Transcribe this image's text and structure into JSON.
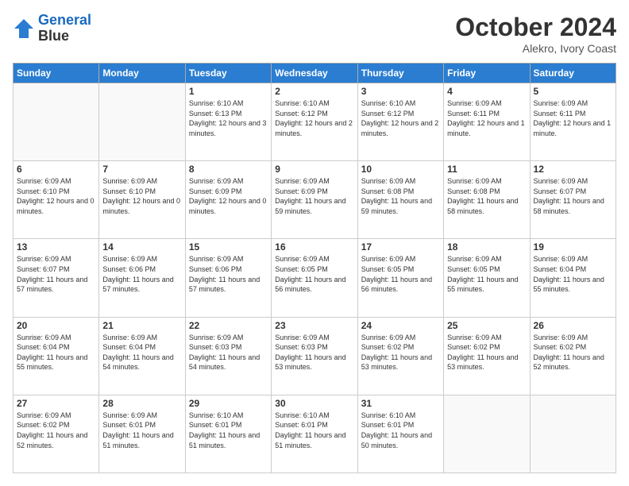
{
  "header": {
    "logo_line1": "General",
    "logo_line2": "Blue",
    "month": "October 2024",
    "location": "Alekro, Ivory Coast"
  },
  "weekdays": [
    "Sunday",
    "Monday",
    "Tuesday",
    "Wednesday",
    "Thursday",
    "Friday",
    "Saturday"
  ],
  "weeks": [
    [
      {
        "day": "",
        "info": ""
      },
      {
        "day": "",
        "info": ""
      },
      {
        "day": "1",
        "info": "Sunrise: 6:10 AM\nSunset: 6:13 PM\nDaylight: 12 hours and 3 minutes."
      },
      {
        "day": "2",
        "info": "Sunrise: 6:10 AM\nSunset: 6:12 PM\nDaylight: 12 hours and 2 minutes."
      },
      {
        "day": "3",
        "info": "Sunrise: 6:10 AM\nSunset: 6:12 PM\nDaylight: 12 hours and 2 minutes."
      },
      {
        "day": "4",
        "info": "Sunrise: 6:09 AM\nSunset: 6:11 PM\nDaylight: 12 hours and 1 minute."
      },
      {
        "day": "5",
        "info": "Sunrise: 6:09 AM\nSunset: 6:11 PM\nDaylight: 12 hours and 1 minute."
      }
    ],
    [
      {
        "day": "6",
        "info": "Sunrise: 6:09 AM\nSunset: 6:10 PM\nDaylight: 12 hours and 0 minutes."
      },
      {
        "day": "7",
        "info": "Sunrise: 6:09 AM\nSunset: 6:10 PM\nDaylight: 12 hours and 0 minutes."
      },
      {
        "day": "8",
        "info": "Sunrise: 6:09 AM\nSunset: 6:09 PM\nDaylight: 12 hours and 0 minutes."
      },
      {
        "day": "9",
        "info": "Sunrise: 6:09 AM\nSunset: 6:09 PM\nDaylight: 11 hours and 59 minutes."
      },
      {
        "day": "10",
        "info": "Sunrise: 6:09 AM\nSunset: 6:08 PM\nDaylight: 11 hours and 59 minutes."
      },
      {
        "day": "11",
        "info": "Sunrise: 6:09 AM\nSunset: 6:08 PM\nDaylight: 11 hours and 58 minutes."
      },
      {
        "day": "12",
        "info": "Sunrise: 6:09 AM\nSunset: 6:07 PM\nDaylight: 11 hours and 58 minutes."
      }
    ],
    [
      {
        "day": "13",
        "info": "Sunrise: 6:09 AM\nSunset: 6:07 PM\nDaylight: 11 hours and 57 minutes."
      },
      {
        "day": "14",
        "info": "Sunrise: 6:09 AM\nSunset: 6:06 PM\nDaylight: 11 hours and 57 minutes."
      },
      {
        "day": "15",
        "info": "Sunrise: 6:09 AM\nSunset: 6:06 PM\nDaylight: 11 hours and 57 minutes."
      },
      {
        "day": "16",
        "info": "Sunrise: 6:09 AM\nSunset: 6:05 PM\nDaylight: 11 hours and 56 minutes."
      },
      {
        "day": "17",
        "info": "Sunrise: 6:09 AM\nSunset: 6:05 PM\nDaylight: 11 hours and 56 minutes."
      },
      {
        "day": "18",
        "info": "Sunrise: 6:09 AM\nSunset: 6:05 PM\nDaylight: 11 hours and 55 minutes."
      },
      {
        "day": "19",
        "info": "Sunrise: 6:09 AM\nSunset: 6:04 PM\nDaylight: 11 hours and 55 minutes."
      }
    ],
    [
      {
        "day": "20",
        "info": "Sunrise: 6:09 AM\nSunset: 6:04 PM\nDaylight: 11 hours and 55 minutes."
      },
      {
        "day": "21",
        "info": "Sunrise: 6:09 AM\nSunset: 6:04 PM\nDaylight: 11 hours and 54 minutes."
      },
      {
        "day": "22",
        "info": "Sunrise: 6:09 AM\nSunset: 6:03 PM\nDaylight: 11 hours and 54 minutes."
      },
      {
        "day": "23",
        "info": "Sunrise: 6:09 AM\nSunset: 6:03 PM\nDaylight: 11 hours and 53 minutes."
      },
      {
        "day": "24",
        "info": "Sunrise: 6:09 AM\nSunset: 6:02 PM\nDaylight: 11 hours and 53 minutes."
      },
      {
        "day": "25",
        "info": "Sunrise: 6:09 AM\nSunset: 6:02 PM\nDaylight: 11 hours and 53 minutes."
      },
      {
        "day": "26",
        "info": "Sunrise: 6:09 AM\nSunset: 6:02 PM\nDaylight: 11 hours and 52 minutes."
      }
    ],
    [
      {
        "day": "27",
        "info": "Sunrise: 6:09 AM\nSunset: 6:02 PM\nDaylight: 11 hours and 52 minutes."
      },
      {
        "day": "28",
        "info": "Sunrise: 6:09 AM\nSunset: 6:01 PM\nDaylight: 11 hours and 51 minutes."
      },
      {
        "day": "29",
        "info": "Sunrise: 6:10 AM\nSunset: 6:01 PM\nDaylight: 11 hours and 51 minutes."
      },
      {
        "day": "30",
        "info": "Sunrise: 6:10 AM\nSunset: 6:01 PM\nDaylight: 11 hours and 51 minutes."
      },
      {
        "day": "31",
        "info": "Sunrise: 6:10 AM\nSunset: 6:01 PM\nDaylight: 11 hours and 50 minutes."
      },
      {
        "day": "",
        "info": ""
      },
      {
        "day": "",
        "info": ""
      }
    ]
  ]
}
